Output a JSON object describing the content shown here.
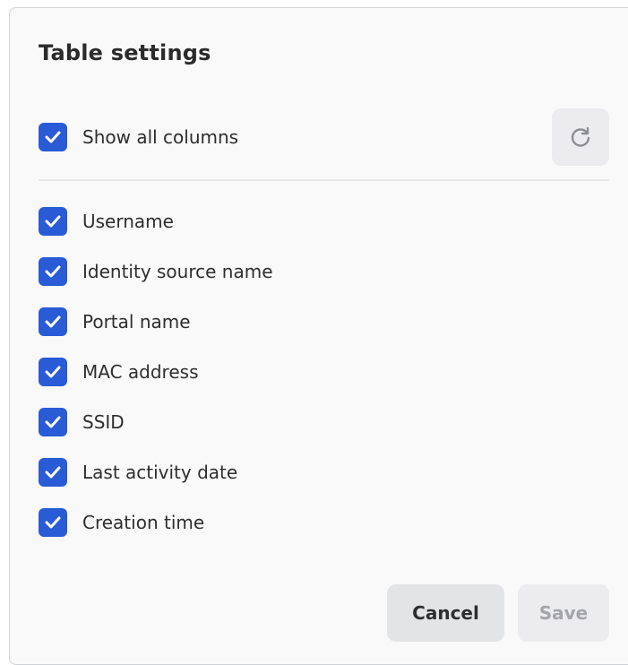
{
  "dialog": {
    "title": "Table settings"
  },
  "show_all": {
    "label": "Show all columns",
    "checked": true
  },
  "reset": {
    "icon": "refresh-icon"
  },
  "columns": [
    {
      "label": "Username",
      "checked": true
    },
    {
      "label": "Identity source name",
      "checked": true
    },
    {
      "label": "Portal name",
      "checked": true
    },
    {
      "label": "MAC address",
      "checked": true
    },
    {
      "label": "SSID",
      "checked": true
    },
    {
      "label": "Last activity date",
      "checked": true
    },
    {
      "label": "Creation time",
      "checked": true
    }
  ],
  "footer": {
    "cancel_label": "Cancel",
    "save_label": "Save"
  },
  "colors": {
    "checkbox": "#2a5bd7",
    "panel_bg": "#f9f9fa",
    "disabled_text": "#a3a5a8"
  }
}
